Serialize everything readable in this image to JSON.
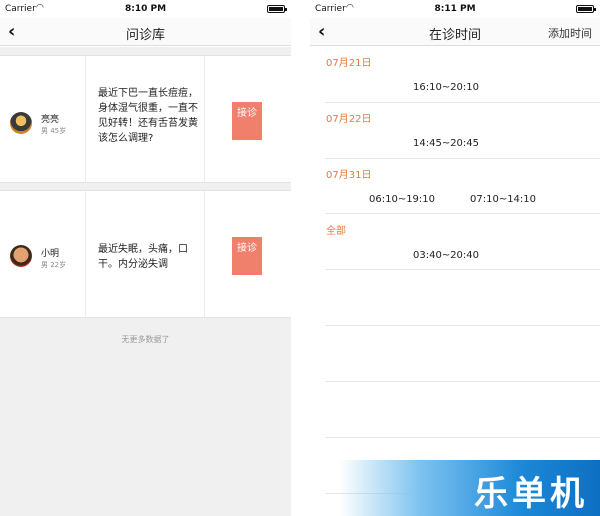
{
  "left": {
    "status": {
      "carrier": "Carrier",
      "time": "8:10 PM"
    },
    "nav": {
      "title": "问诊库"
    },
    "cards": [
      {
        "name": "亮亮",
        "meta": "男 45岁",
        "text": "最近下巴一直长痘痘，身体湿气很重，一直不见好转！还有舌苔发黄该怎么调理?",
        "button": "接诊"
      },
      {
        "name": "小明",
        "meta": "男 22岁",
        "text": "最近失眠，头痛，口干。内分泌失调",
        "button": "接诊"
      }
    ],
    "no_more": "无更多数据了"
  },
  "right": {
    "status": {
      "carrier": "Carrier",
      "time": "8:11 PM"
    },
    "nav": {
      "title": "在诊时间",
      "action": "添加时间"
    },
    "days": [
      {
        "date": "07月21日",
        "slots": [
          "16:10~20:10"
        ]
      },
      {
        "date": "07月22日",
        "slots": [
          "14:45~20:45"
        ]
      },
      {
        "date": "07月31日",
        "slots": [
          "06:10~19:10",
          "07:10~14:10"
        ]
      },
      {
        "date": "全部",
        "slots": [
          "03:40~20:40"
        ]
      }
    ]
  },
  "watermark": {
    "text": "乐单机"
  },
  "colors": {
    "accent_orange": "#e87a3c",
    "accept_button": "#f07f6c",
    "watermark_blue": "#1c88d8"
  }
}
